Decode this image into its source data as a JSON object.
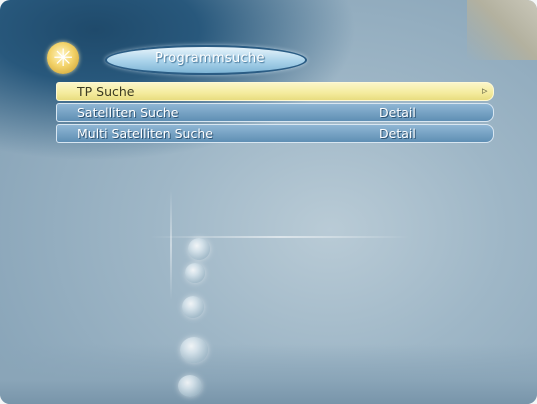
{
  "header": {
    "title": "Programmsuche",
    "logo_icon": "star-badge-icon"
  },
  "menu": {
    "items": [
      {
        "label": "TP Suche",
        "value": "",
        "selected": true
      },
      {
        "label": "Satelliten Suche",
        "value": "Detail",
        "selected": false
      },
      {
        "label": "Multi Satelliten Suche",
        "value": "Detail",
        "selected": false
      }
    ],
    "cursor_icon": "arrow-cursor-icon"
  },
  "colors": {
    "highlight": "#f4eb9d",
    "row": "#6f9cc0",
    "title_pill": "#a9d2ea"
  }
}
